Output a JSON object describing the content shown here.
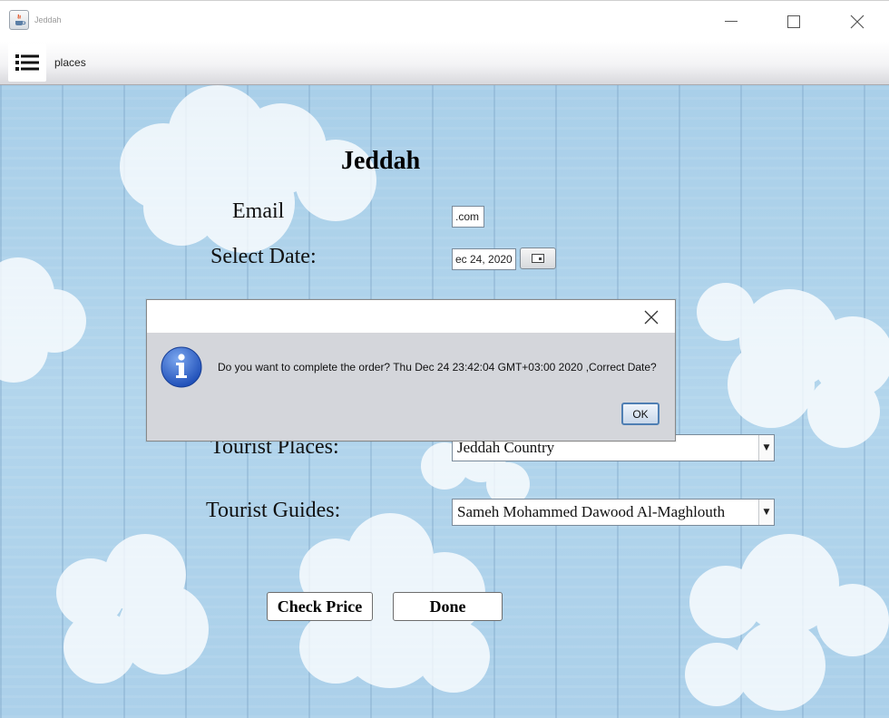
{
  "window": {
    "title": "Jeddah"
  },
  "menubar": {
    "menu_label": "places"
  },
  "form": {
    "heading": "Jeddah",
    "email_label": "Email",
    "email_value": ".com",
    "date_label": "Select Date:",
    "date_value": "ec 24, 2020",
    "places_label": "Tourist Places:",
    "places_value": "Jeddah Country",
    "guides_label": "Tourist Guides:",
    "guides_value": "Sameh Mohammed Dawood Al-Maghlouth",
    "check_price_label": "Check Price",
    "done_label": "Done"
  },
  "dialog": {
    "message": "Do you want to complete the order? Thu Dec 24 23:42:04 GMT+03:00 2020 ,Correct Date?",
    "ok_label": "OK"
  },
  "colors": {
    "sky": "#abd0ea",
    "dialog_bg": "#d4d6db",
    "info_icon": "#2d63c8"
  }
}
